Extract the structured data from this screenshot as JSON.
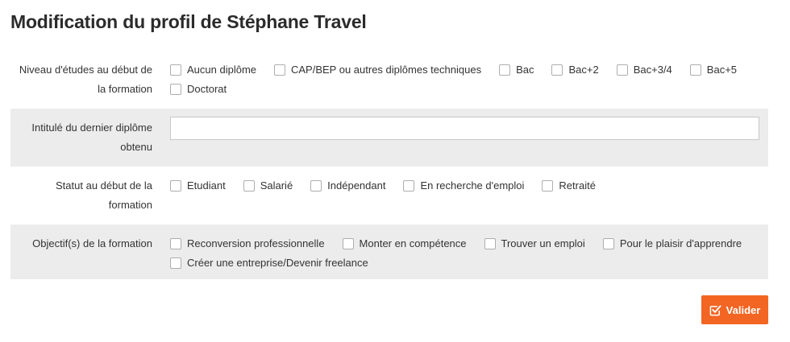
{
  "page": {
    "title": "Modification du profil de Stéphane Travel"
  },
  "education": {
    "label_line1": "Niveau d'études au début de",
    "label_line2": "la formation",
    "options": [
      "Aucun diplôme",
      "CAP/BEP ou autres diplômes techniques",
      "Bac",
      "Bac+2",
      "Bac+3/4",
      "Bac+5",
      "Doctorat"
    ]
  },
  "diploma": {
    "label_line1": "Intitulé du dernier diplôme",
    "label_line2": "obtenu",
    "value": "",
    "placeholder": ""
  },
  "status": {
    "label_line1": "Statut au début de la",
    "label_line2": "formation",
    "options": [
      "Etudiant",
      "Salarié",
      "Indépendant",
      "En recherche d'emploi",
      "Retraité"
    ]
  },
  "objectives": {
    "label": "Objectif(s) de la formation",
    "options": [
      "Reconversion professionnelle",
      "Monter en compétence",
      "Trouver un emploi",
      "Pour le plaisir d'apprendre",
      "Créer une entreprise/Devenir freelance"
    ]
  },
  "submit": {
    "label": "Valider",
    "icon": "check-square-icon",
    "color": "#f26522"
  },
  "colors": {
    "row_grey": "#ececec",
    "text": "#2b2b2b"
  }
}
